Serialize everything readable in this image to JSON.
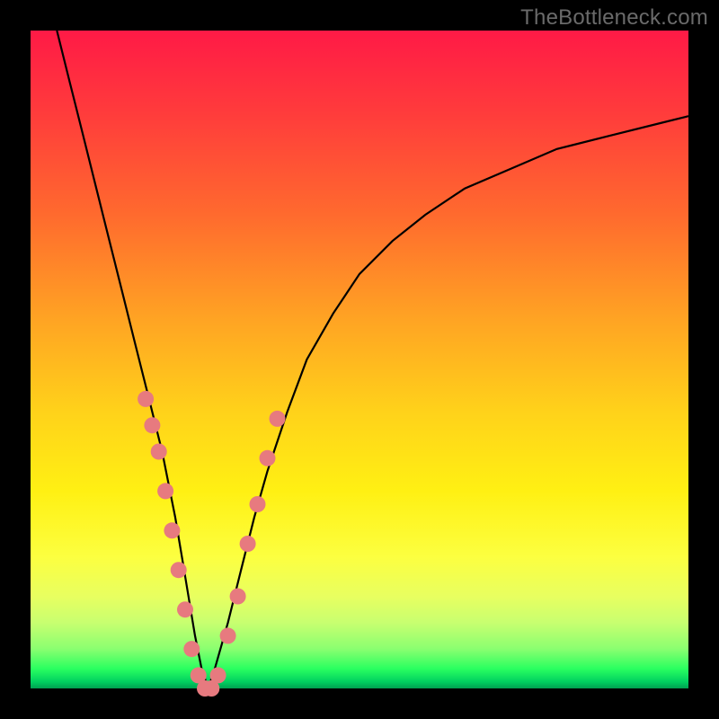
{
  "watermark": "TheBottleneck.com",
  "colors": {
    "dot": "#e77a7f",
    "curve": "#000000",
    "frame": "#000000"
  },
  "chart_data": {
    "type": "line",
    "title": "",
    "xlabel": "",
    "ylabel": "",
    "xlim": [
      0,
      100
    ],
    "ylim": [
      0,
      100
    ],
    "note": "No numeric axis ticks are rendered; x/y are normalized 0–100 estimates from pixel position.",
    "series": [
      {
        "name": "bottleneck-curve",
        "x": [
          4,
          6,
          8,
          10,
          12,
          14,
          16,
          18,
          20,
          22,
          23,
          24,
          25,
          26,
          27,
          28,
          30,
          32,
          34,
          36,
          39,
          42,
          46,
          50,
          55,
          60,
          66,
          73,
          80,
          88,
          96,
          100
        ],
        "y": [
          100,
          92,
          84,
          76,
          68,
          60,
          52,
          44,
          36,
          26,
          20,
          14,
          8,
          3,
          0,
          3,
          10,
          18,
          26,
          33,
          42,
          50,
          57,
          63,
          68,
          72,
          76,
          79,
          82,
          84,
          86,
          87
        ]
      }
    ],
    "markers": {
      "name": "highlighted-points",
      "note": "Pink dots clustered near the curve minimum on both branches.",
      "points": [
        {
          "x": 17.5,
          "y": 44
        },
        {
          "x": 18.5,
          "y": 40
        },
        {
          "x": 19.5,
          "y": 36
        },
        {
          "x": 20.5,
          "y": 30
        },
        {
          "x": 21.5,
          "y": 24
        },
        {
          "x": 22.5,
          "y": 18
        },
        {
          "x": 23.5,
          "y": 12
        },
        {
          "x": 24.5,
          "y": 6
        },
        {
          "x": 25.5,
          "y": 2
        },
        {
          "x": 26.5,
          "y": 0
        },
        {
          "x": 27.5,
          "y": 0
        },
        {
          "x": 28.5,
          "y": 2
        },
        {
          "x": 30.0,
          "y": 8
        },
        {
          "x": 31.5,
          "y": 14
        },
        {
          "x": 33.0,
          "y": 22
        },
        {
          "x": 34.5,
          "y": 28
        },
        {
          "x": 36.0,
          "y": 35
        },
        {
          "x": 37.5,
          "y": 41
        }
      ]
    }
  }
}
